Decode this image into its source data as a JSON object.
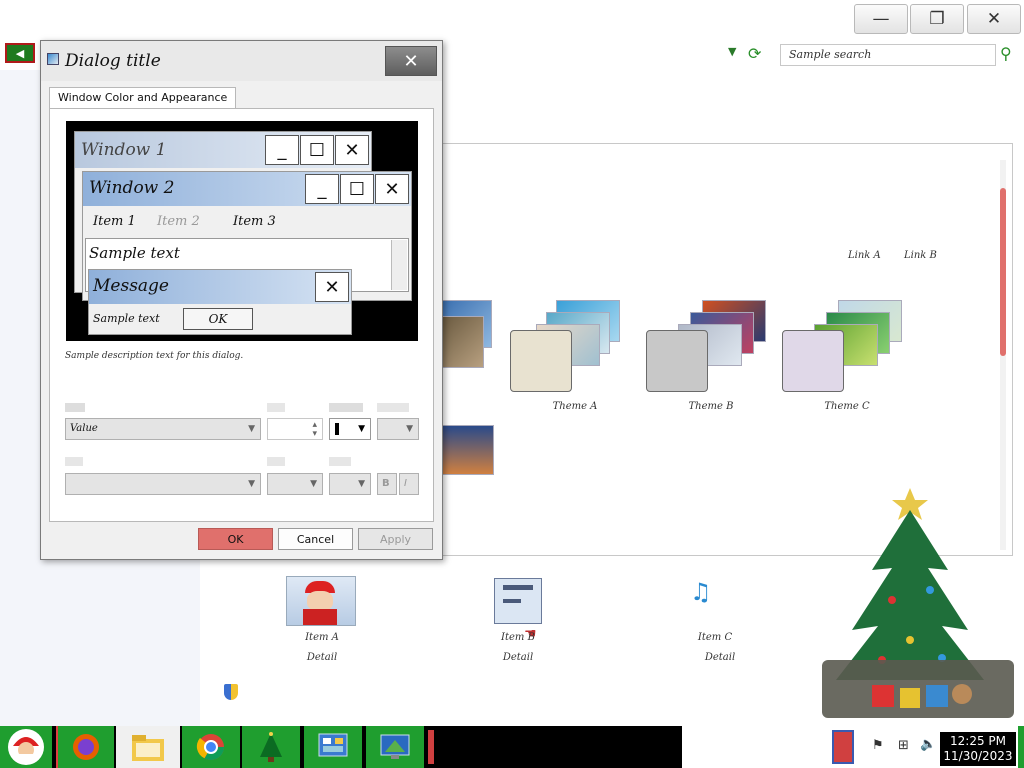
{
  "control_panel": {
    "title_buttons": {
      "minimize": "—",
      "restore": "❐",
      "close": "✕"
    },
    "search_placeholder": "Sample search"
  },
  "themes_pane": {
    "top_links": [
      "Link A",
      "Link B"
    ],
    "themes": [
      {
        "name": "Theme A"
      },
      {
        "name": "Theme B"
      },
      {
        "name": "Theme C"
      }
    ]
  },
  "bottom_items": [
    {
      "title": "Item A",
      "subtitle": "Detail"
    },
    {
      "title": "Item B",
      "subtitle": "Detail"
    },
    {
      "title": "Item C",
      "subtitle": "Detail"
    }
  ],
  "dialog": {
    "title": "Dialog title",
    "tab_label": "Window Color and Appearance",
    "preview": {
      "inactive_title": "Window 1",
      "active_title": "Window 2",
      "menu_items": [
        "Item 1",
        "Item 2",
        "Item 3"
      ],
      "window_text": "Sample text",
      "message_box_title": "Message",
      "message_text": "Sample text",
      "ok_button": "OK"
    },
    "description": "Sample description text for this dialog.",
    "item_value": "Value"
  },
  "buttons": {
    "ok": "OK",
    "cancel": "Cancel",
    "apply": "Apply"
  },
  "taskbar": {
    "time": "12:25 PM",
    "date": "11/30/2023"
  },
  "colors": {
    "ok_button": "#e0706c",
    "scrollbar_thumb": "#e0706c",
    "taskbar": "#000000",
    "taskbar_icon_bg": "#1f9e2f"
  }
}
